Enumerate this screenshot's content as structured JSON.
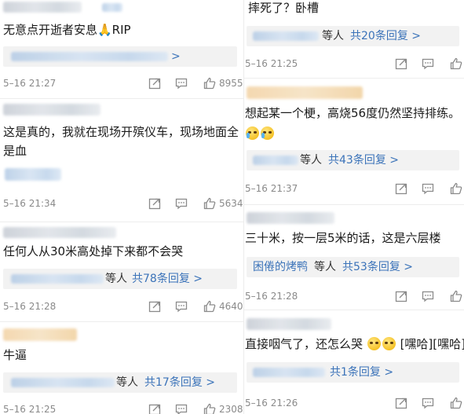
{
  "left": [
    {
      "text": "无意点开逝者安息🙏RIP",
      "reply": {
        "users": "",
        "link": ">"
      },
      "time": "5–16 21:27",
      "likes": "8955"
    },
    {
      "text": "这是真的，我就在现场开殡仪车，现场地面全是血",
      "reply": null,
      "time": "5–16 21:34",
      "likes": "5634"
    },
    {
      "text": "任何人从30米高处掉下来都不会哭",
      "reply": {
        "users": "等人",
        "link": "共78条回复 >"
      },
      "time": "5–16 21:28",
      "likes": "4640"
    },
    {
      "text": "牛逼",
      "reply": {
        "users": "等人",
        "link": "共17条回复 >"
      },
      "time": "5–16 21:25",
      "likes": "2308"
    }
  ],
  "right": [
    {
      "text": "摔死了？卧槽",
      "reply": {
        "users": "等人",
        "link": "共20条回复 >"
      },
      "time": "5–16 21:25"
    },
    {
      "text": "想起某一个梗，高烧56度仍然坚持排练。",
      "reply": {
        "users": "等人",
        "link": "共43条回复 >"
      },
      "time": "5–16 21:37"
    },
    {
      "text": "三十米，按一层5米的话，这是六层楼",
      "reply": {
        "user_named": "困倦的烤鸭",
        "users": "等人",
        "link": "共53条回复 >"
      },
      "time": "5–16 21:28"
    },
    {
      "text_before": "直接咽气了，还怎么哭",
      "text_after": "[嘿哈][嘿哈]",
      "reply": {
        "users": "",
        "link": "共1条回复 >"
      },
      "time": "5–16 21:26"
    }
  ],
  "icons": [
    "share-icon",
    "comment-icon",
    "like-icon"
  ]
}
